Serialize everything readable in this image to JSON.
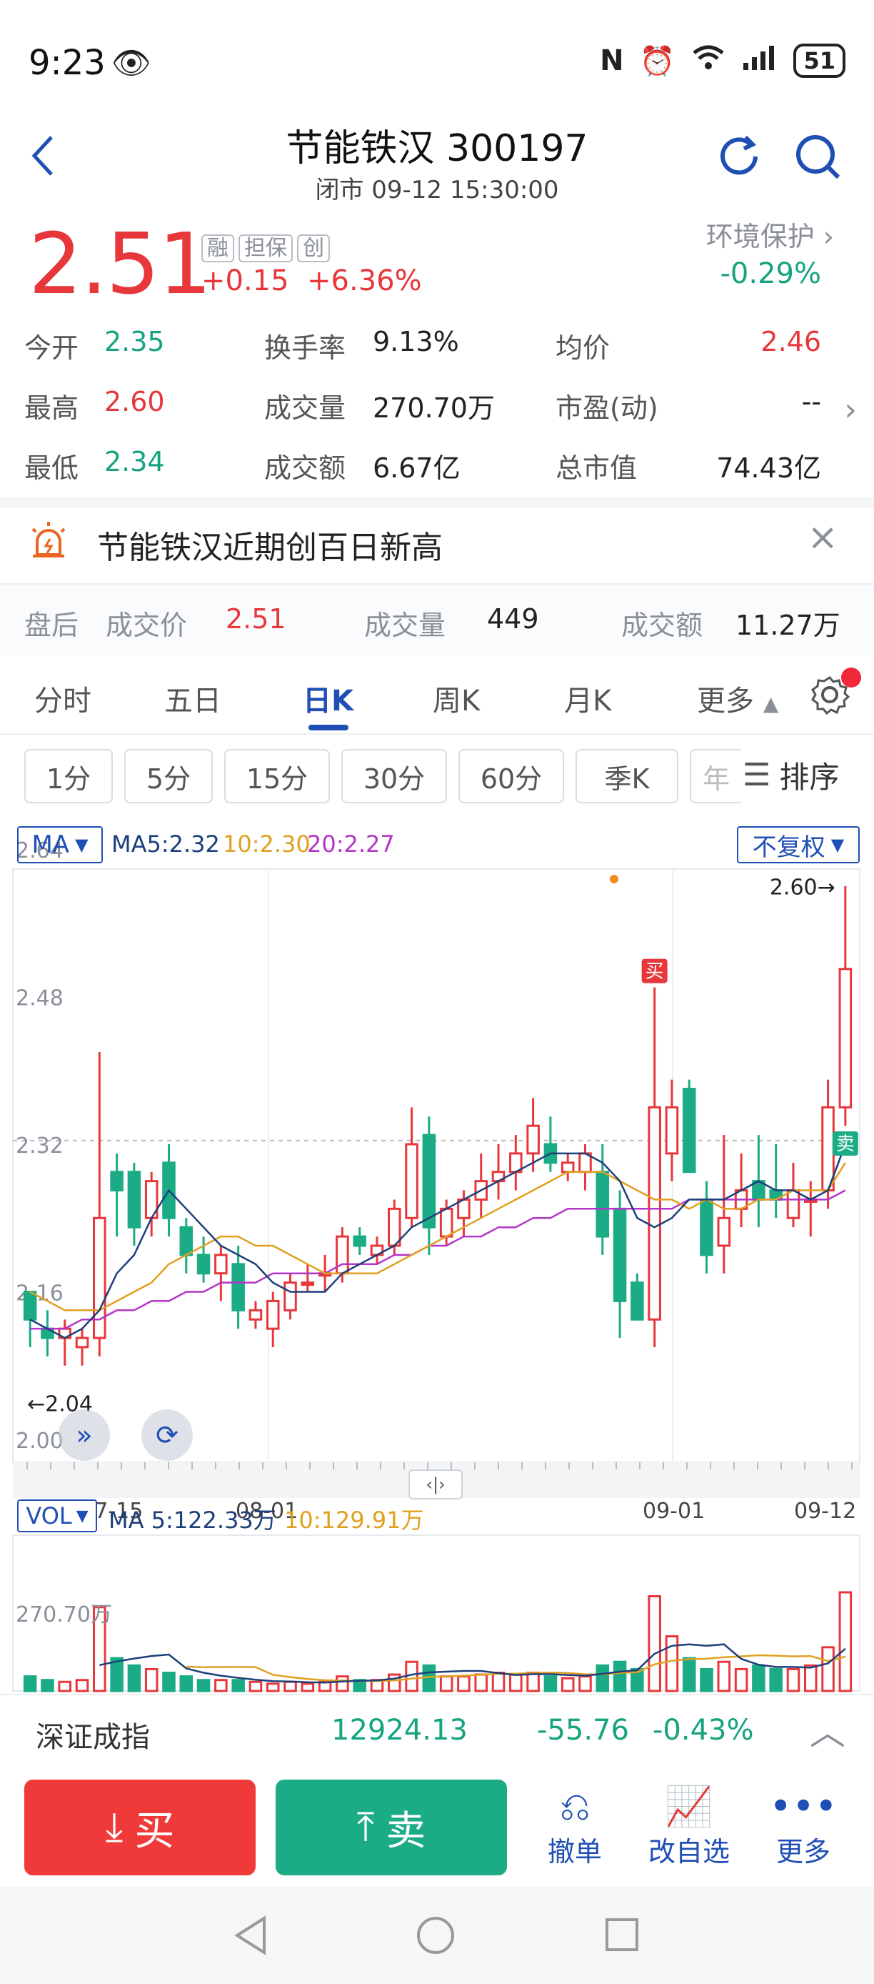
{
  "status_bar": {
    "time": "9:23",
    "battery": "51"
  },
  "header": {
    "title": "节能铁汉 300197",
    "subtitle": "闭市 09-12 15:30:00"
  },
  "quote": {
    "price": "2.51",
    "change": "+0.15",
    "change_pct": "+6.36%",
    "tags": [
      "融",
      "担保",
      "创"
    ],
    "sector_name": "环境保护",
    "sector_change": "-0.29%",
    "stats": [
      {
        "label": "今开",
        "value": "2.35",
        "color": "#16a37f"
      },
      {
        "label": "换手率",
        "value": "9.13%",
        "color": "#222222"
      },
      {
        "label": "均价",
        "value": "2.46",
        "color": "#e8373b"
      },
      {
        "label": "最高",
        "value": "2.60",
        "color": "#e8373b"
      },
      {
        "label": "成交量",
        "value": "270.70万",
        "color": "#222222"
      },
      {
        "label": "市盈(动)",
        "value": "--",
        "color": "#222222"
      },
      {
        "label": "最低",
        "value": "2.34",
        "color": "#16a37f"
      },
      {
        "label": "成交额",
        "value": "6.67亿",
        "color": "#222222"
      },
      {
        "label": "总市值",
        "value": "74.43亿",
        "color": "#222222"
      }
    ]
  },
  "alert": {
    "text": "节能铁汉近期创百日新高"
  },
  "after_hours": {
    "label": "盘后",
    "price_label": "成交价",
    "price": "2.51",
    "vol_label": "成交量",
    "vol": "449",
    "amt_label": "成交额",
    "amt": "11.27万"
  },
  "tabs": [
    "分时",
    "五日",
    "日K",
    "周K",
    "月K",
    "更多"
  ],
  "active_tab": "日K",
  "periods": [
    "1分",
    "5分",
    "15分",
    "30分",
    "60分",
    "季K",
    "年"
  ],
  "sort_label": "排序",
  "chart": {
    "ma_selector": "MA",
    "ma5": "MA5:2.32",
    "ma10": "10:2.30",
    "ma20": "20:2.27",
    "adjust": "不复权",
    "y_labels": [
      "2.64",
      "2.48",
      "2.32",
      "2.16",
      "2.00"
    ],
    "x_labels": [
      "2025-07-15",
      "08-01",
      "09-01",
      "09-12"
    ],
    "high_mark": "2.60→",
    "low_mark": "←2.04",
    "buy_mark": "买",
    "sell_mark": "卖",
    "vol_selector": "VOL",
    "vol_ma5": "MA 5:122.33万",
    "vol_ma10": "10:129.91万",
    "vol_max": "270.70万"
  },
  "chart_data": {
    "type": "candlestick",
    "x_start": "2025-07-15",
    "x_end": "2025-09-12",
    "ylim": [
      2.0,
      2.64
    ],
    "candles": [
      [
        2.16,
        2.16,
        2.1,
        2.13
      ],
      [
        2.12,
        2.14,
        2.09,
        2.11
      ],
      [
        2.11,
        2.13,
        2.08,
        2.12
      ],
      [
        2.1,
        2.12,
        2.08,
        2.11
      ],
      [
        2.11,
        2.42,
        2.09,
        2.24
      ],
      [
        2.29,
        2.31,
        2.22,
        2.27
      ],
      [
        2.29,
        2.3,
        2.21,
        2.23
      ],
      [
        2.24,
        2.29,
        2.22,
        2.28
      ],
      [
        2.3,
        2.32,
        2.22,
        2.24
      ],
      [
        2.23,
        2.24,
        2.18,
        2.2
      ],
      [
        2.2,
        2.22,
        2.17,
        2.18
      ],
      [
        2.18,
        2.21,
        2.15,
        2.2
      ],
      [
        2.19,
        2.21,
        2.12,
        2.14
      ],
      [
        2.13,
        2.15,
        2.12,
        2.14
      ],
      [
        2.12,
        2.16,
        2.1,
        2.15
      ],
      [
        2.14,
        2.18,
        2.13,
        2.17
      ],
      [
        2.17,
        2.19,
        2.16,
        2.17
      ],
      [
        2.18,
        2.2,
        2.16,
        2.18
      ],
      [
        2.18,
        2.23,
        2.17,
        2.22
      ],
      [
        2.22,
        2.23,
        2.2,
        2.21
      ],
      [
        2.2,
        2.22,
        2.19,
        2.21
      ],
      [
        2.21,
        2.26,
        2.2,
        2.25
      ],
      [
        2.24,
        2.36,
        2.23,
        2.32
      ],
      [
        2.33,
        2.35,
        2.2,
        2.23
      ],
      [
        2.22,
        2.26,
        2.21,
        2.25
      ],
      [
        2.24,
        2.27,
        2.22,
        2.26
      ],
      [
        2.26,
        2.31,
        2.24,
        2.28
      ],
      [
        2.28,
        2.32,
        2.26,
        2.29
      ],
      [
        2.29,
        2.33,
        2.27,
        2.31
      ],
      [
        2.31,
        2.37,
        2.29,
        2.34
      ],
      [
        2.32,
        2.35,
        2.29,
        2.3
      ],
      [
        2.29,
        2.31,
        2.28,
        2.3
      ],
      [
        2.29,
        2.32,
        2.27,
        2.31
      ],
      [
        2.29,
        2.32,
        2.2,
        2.22
      ],
      [
        2.25,
        2.27,
        2.11,
        2.15
      ],
      [
        2.17,
        2.18,
        2.13,
        2.13
      ],
      [
        2.13,
        2.49,
        2.1,
        2.36
      ],
      [
        2.31,
        2.39,
        2.28,
        2.36
      ],
      [
        2.38,
        2.39,
        2.29,
        2.29
      ],
      [
        2.26,
        2.28,
        2.18,
        2.2
      ],
      [
        2.21,
        2.33,
        2.18,
        2.24
      ],
      [
        2.25,
        2.31,
        2.23,
        2.27
      ],
      [
        2.28,
        2.33,
        2.23,
        2.26
      ],
      [
        2.27,
        2.32,
        2.24,
        2.26
      ],
      [
        2.24,
        2.3,
        2.23,
        2.27
      ],
      [
        2.26,
        2.28,
        2.22,
        2.26
      ],
      [
        2.27,
        2.39,
        2.25,
        2.36
      ],
      [
        2.36,
        2.6,
        2.34,
        2.51
      ]
    ],
    "ma5": [
      2.13,
      2.12,
      2.11,
      2.12,
      2.14,
      2.18,
      2.2,
      2.24,
      2.27,
      2.25,
      2.23,
      2.21,
      2.2,
      2.19,
      2.17,
      2.16,
      2.16,
      2.16,
      2.18,
      2.19,
      2.2,
      2.21,
      2.23,
      2.24,
      2.25,
      2.26,
      2.27,
      2.28,
      2.29,
      2.3,
      2.31,
      2.31,
      2.31,
      2.3,
      2.28,
      2.24,
      2.23,
      2.24,
      2.26,
      2.26,
      2.26,
      2.27,
      2.28,
      2.27,
      2.27,
      2.26,
      2.27,
      2.32
    ],
    "ma10": [
      2.16,
      2.15,
      2.14,
      2.14,
      2.14,
      2.15,
      2.16,
      2.17,
      2.19,
      2.2,
      2.21,
      2.22,
      2.22,
      2.21,
      2.21,
      2.2,
      2.19,
      2.18,
      2.18,
      2.18,
      2.18,
      2.19,
      2.2,
      2.21,
      2.22,
      2.23,
      2.24,
      2.25,
      2.26,
      2.27,
      2.28,
      2.29,
      2.29,
      2.29,
      2.28,
      2.27,
      2.26,
      2.26,
      2.25,
      2.26,
      2.25,
      2.25,
      2.26,
      2.26,
      2.27,
      2.27,
      2.27,
      2.3
    ],
    "ma20": [
      2.12,
      2.12,
      2.12,
      2.13,
      2.13,
      2.14,
      2.14,
      2.15,
      2.15,
      2.16,
      2.16,
      2.17,
      2.17,
      2.17,
      2.18,
      2.18,
      2.18,
      2.18,
      2.19,
      2.19,
      2.19,
      2.2,
      2.2,
      2.21,
      2.21,
      2.22,
      2.22,
      2.23,
      2.23,
      2.24,
      2.24,
      2.25,
      2.25,
      2.25,
      2.25,
      2.25,
      2.25,
      2.25,
      2.26,
      2.26,
      2.26,
      2.26,
      2.26,
      2.26,
      2.26,
      2.26,
      2.26,
      2.27
    ],
    "volume_max": 270.7,
    "volumes": [
      40,
      30,
      25,
      30,
      230,
      90,
      70,
      60,
      50,
      40,
      30,
      30,
      30,
      25,
      20,
      25,
      20,
      25,
      40,
      30,
      30,
      45,
      80,
      70,
      40,
      40,
      45,
      50,
      45,
      50,
      40,
      35,
      40,
      70,
      80,
      60,
      260,
      150,
      90,
      60,
      80,
      60,
      70,
      60,
      60,
      70,
      120,
      270.7
    ]
  }
}
